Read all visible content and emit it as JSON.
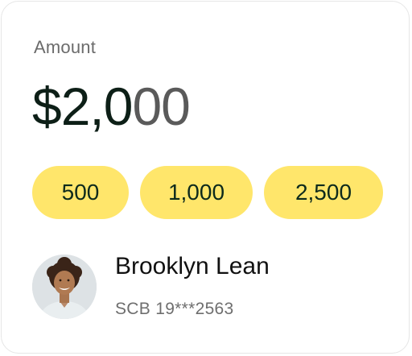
{
  "amount_card": {
    "label": "Amount",
    "amount_main": "$2,0",
    "amount_ghost": "00",
    "presets": [
      "500",
      "1,000",
      "2,500"
    ]
  },
  "recipient": {
    "name": "Brooklyn Lean",
    "account": "SCB 19***2563",
    "avatar_icon": "person-avatar-icon"
  },
  "colors": {
    "chip_bg": "#ffe66b",
    "amount_text": "#0d1f17",
    "amount_placeholder": "#5a5a5a"
  }
}
